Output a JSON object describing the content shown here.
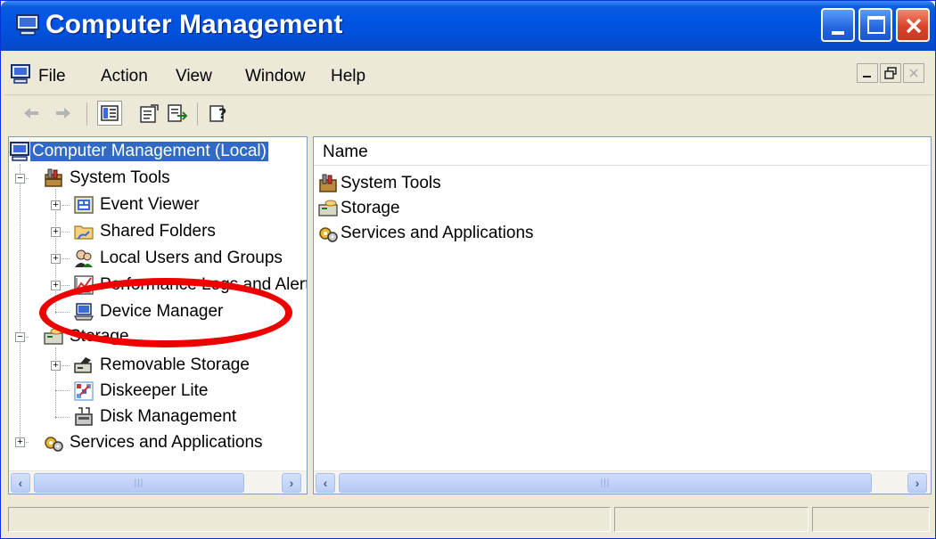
{
  "window": {
    "title": "Computer Management",
    "controls": {
      "minimize": "minimize",
      "maximize": "maximize",
      "close": "close"
    }
  },
  "menubar": {
    "items": [
      "File",
      "Action",
      "View",
      "Window",
      "Help"
    ]
  },
  "toolbar": {
    "buttons": [
      "back-icon",
      "forward-icon",
      "show-hide-tree-icon",
      "properties-icon",
      "export-list-icon",
      "help-icon"
    ]
  },
  "tree": {
    "root": {
      "label": "Computer Management (Local)",
      "icon": "computer-icon"
    },
    "nodes": [
      {
        "label": "System Tools",
        "icon": "toolbox-icon",
        "expanded": true
      },
      {
        "label": "Event Viewer",
        "icon": "event-viewer-icon"
      },
      {
        "label": "Shared Folders",
        "icon": "folder-icon"
      },
      {
        "label": "Local Users and Groups",
        "icon": "users-icon"
      },
      {
        "label": "Performance Logs and Alerts",
        "icon": "performance-icon"
      },
      {
        "label": "Device Manager",
        "icon": "device-manager-icon"
      },
      {
        "label": "Storage",
        "icon": "storage-icon",
        "expanded": true
      },
      {
        "label": "Removable Storage",
        "icon": "removable-storage-icon"
      },
      {
        "label": "Diskeeper Lite",
        "icon": "diskeeper-icon"
      },
      {
        "label": "Disk Management",
        "icon": "disk-management-icon"
      },
      {
        "label": "Services and Applications",
        "icon": "services-icon"
      }
    ]
  },
  "list": {
    "column_header": "Name",
    "items": [
      {
        "label": "System Tools",
        "icon": "toolbox-icon"
      },
      {
        "label": "Storage",
        "icon": "storage-icon"
      },
      {
        "label": "Services and Applications",
        "icon": "services-icon"
      }
    ]
  },
  "annotation": {
    "color": "#ee0000",
    "target": "Device Manager"
  },
  "colors": {
    "titlebar": "#0054e3",
    "selection": "#316ac5",
    "window_bg": "#ece9d8"
  }
}
